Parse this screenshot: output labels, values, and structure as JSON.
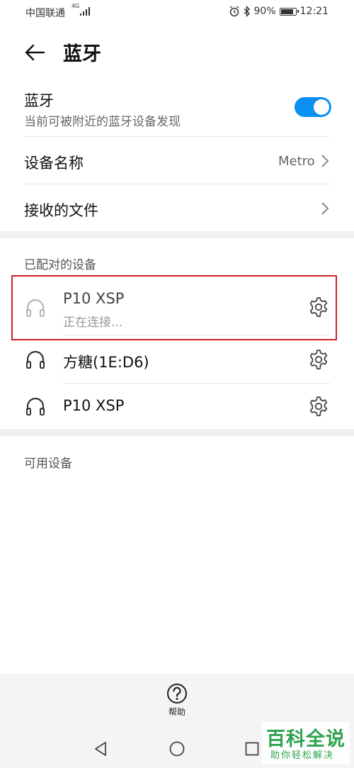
{
  "status_bar": {
    "carrier": "中国联通",
    "network_type": "4G",
    "battery": "90%",
    "battery_level": 0.9,
    "time": "12:21",
    "icons": [
      "signal-icon",
      "alarm-icon",
      "bluetooth-icon",
      "battery-icon"
    ]
  },
  "header": {
    "back_icon": "back-arrow-icon",
    "title": "蓝牙"
  },
  "bluetooth": {
    "title": "蓝牙",
    "subtitle": "当前可被附近的蓝牙设备发现",
    "enabled": true,
    "accent_color": "#0a8ff2"
  },
  "settings": {
    "device_name_label": "设备名称",
    "device_name_value": "Metro",
    "received_files_label": "接收的文件"
  },
  "paired": {
    "section_label": "已配对的设备",
    "devices": [
      {
        "name": "P10  XSP",
        "status": "正在连接...",
        "icon": "headphones-icon"
      },
      {
        "name": "方糖(1E:D6)",
        "status": "",
        "icon": "headphones-icon"
      },
      {
        "name": "P10  XSP",
        "status": "",
        "icon": "headphones-icon"
      }
    ]
  },
  "available": {
    "section_label": "可用设备"
  },
  "bottom": {
    "help_label": "帮助",
    "help_icon": "question-icon"
  },
  "nav_bar": {
    "icons": [
      "nav-back-icon",
      "nav-home-icon",
      "nav-recents-icon"
    ]
  },
  "watermark": {
    "main": "百科全说",
    "sub": "助你轻松解决"
  }
}
